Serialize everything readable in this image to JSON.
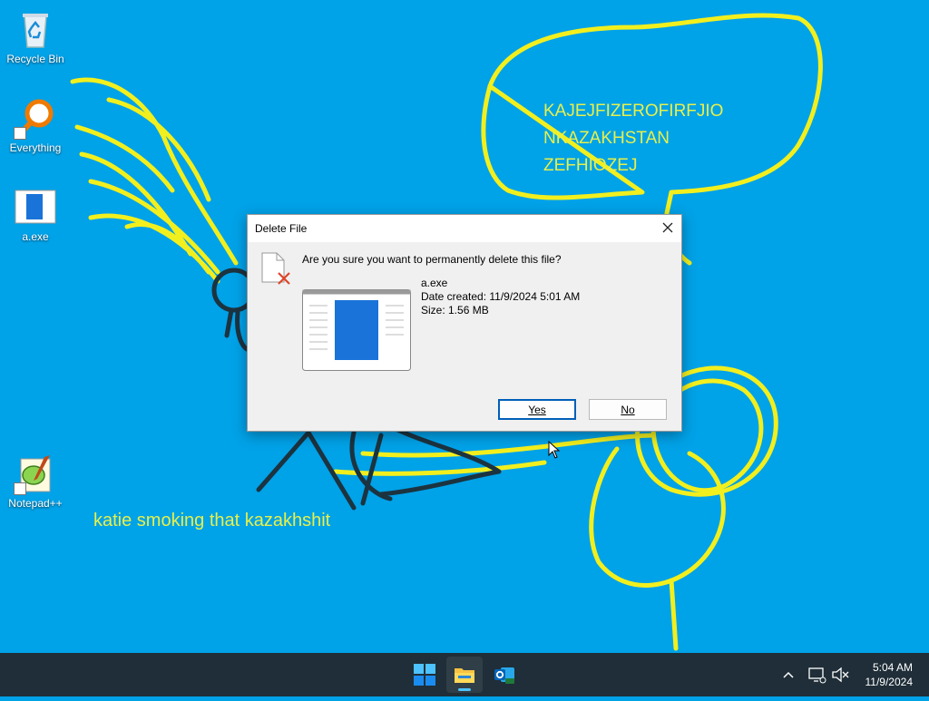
{
  "desktop": {
    "icons": [
      {
        "label": "Recycle Bin",
        "icon": "recycle-bin-icon"
      },
      {
        "label": "Everything",
        "icon": "search-magnifier-icon"
      },
      {
        "label": "a.exe",
        "icon": "exe-file-icon"
      },
      {
        "label": "Notepad++",
        "icon": "notepad-plus-plus-icon"
      }
    ],
    "wallpaper_text": {
      "bubble_lines": [
        "KAJEJFIZEROFIRFJIO",
        "NKAZAKHSTAN",
        "ZEFHIOZEJ"
      ],
      "caption": "katie smoking that kazakhshit"
    },
    "colors": {
      "background": "#00a2e8",
      "scribble_yellow": "#f2ef1e",
      "scribble_dark": "#1c3340"
    }
  },
  "dialog": {
    "title": "Delete File",
    "question": "Are you sure you want to permanently delete this file?",
    "file_name": "a.exe",
    "date_created": "Date created: 11/9/2024 5:01 AM",
    "size": "Size: 1.56 MB",
    "yes_label": "Yes",
    "no_label": "No"
  },
  "taskbar": {
    "apps": [
      {
        "name": "Start",
        "icon": "windows-start-icon"
      },
      {
        "name": "File Explorer",
        "icon": "file-explorer-icon",
        "active": true
      },
      {
        "name": "Outlook (new)",
        "icon": "outlook-icon"
      }
    ],
    "clock": {
      "time": "5:04 AM",
      "date": "11/9/2024"
    }
  }
}
